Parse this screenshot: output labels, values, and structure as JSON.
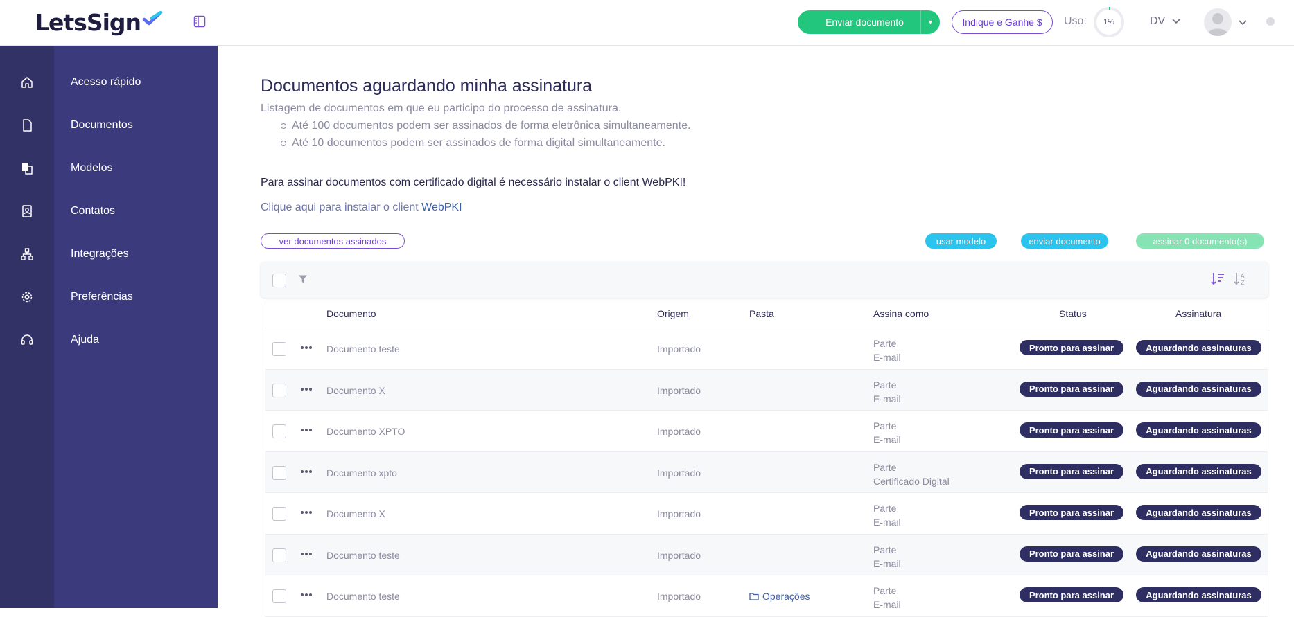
{
  "header": {
    "logo": "LetsSign",
    "send_button": "Enviar documento",
    "refer_button": "Indique e Ganhe $",
    "usage_label": "Uso:",
    "usage_value": "1%",
    "usage_fraction": 0.01,
    "user_initials": "DV"
  },
  "sidebar": {
    "items": [
      {
        "label": "Acesso rápido",
        "icon": "home-icon"
      },
      {
        "label": "Documentos",
        "icon": "document-icon"
      },
      {
        "label": "Modelos",
        "icon": "templates-icon"
      },
      {
        "label": "Contatos",
        "icon": "contacts-icon"
      },
      {
        "label": "Integrações",
        "icon": "integrations-icon"
      },
      {
        "label": "Preferências",
        "icon": "gear-icon"
      },
      {
        "label": "Ajuda",
        "icon": "headset-icon"
      }
    ]
  },
  "main": {
    "title": "Documentos aguardando minha assinatura",
    "subtitle": "Listagem de documentos em que eu participo do processo de assinatura.",
    "bullets": [
      "Até 100 documentos podem ser assinados de forma eletrônica simultaneamente.",
      "Até 10 documentos podem ser assinados de forma digital simultaneamente."
    ],
    "note": "Para assinar documentos com certificado digital é necessário instalar o client WebPKI!",
    "install_prefix": "Clique aqui para instalar o client ",
    "install_link": "WebPKI",
    "view_signed_button": "ver documentos assinados",
    "use_template_button": "usar modelo",
    "send_document_button": "enviar documento",
    "sign_button": "assinar 0 documento(s)"
  },
  "colors": {
    "sidebar_rail": "#333266",
    "sidebar_panel": "#3b3a7c",
    "primary_green": "#22c77d",
    "accent_purple": "#7b4dd6",
    "cyan": "#2bc4ee",
    "badge_dark": "#2f2e62"
  },
  "table": {
    "columns": {
      "document": "Documento",
      "origin": "Origem",
      "folder": "Pasta",
      "sign_as": "Assina como",
      "status": "Status",
      "signature": "Assinatura"
    },
    "rows": [
      {
        "document": "Documento teste",
        "origin": "Importado",
        "folder": "",
        "sign_role": "Parte",
        "sign_method": "E-mail",
        "status": "Pronto para assinar",
        "signature": "Aguardando assinaturas"
      },
      {
        "document": "Documento X",
        "origin": "Importado",
        "folder": "",
        "sign_role": "Parte",
        "sign_method": "E-mail",
        "status": "Pronto para assinar",
        "signature": "Aguardando assinaturas"
      },
      {
        "document": "Documento XPTO",
        "origin": "Importado",
        "folder": "",
        "sign_role": "Parte",
        "sign_method": "E-mail",
        "status": "Pronto para assinar",
        "signature": "Aguardando assinaturas"
      },
      {
        "document": "Documento xpto",
        "origin": "Importado",
        "folder": "",
        "sign_role": "Parte",
        "sign_method": "Certificado Digital",
        "status": "Pronto para assinar",
        "signature": "Aguardando assinaturas"
      },
      {
        "document": "Documento X",
        "origin": "Importado",
        "folder": "",
        "sign_role": "Parte",
        "sign_method": "E-mail",
        "status": "Pronto para assinar",
        "signature": "Aguardando assinaturas"
      },
      {
        "document": "Documento teste",
        "origin": "Importado",
        "folder": "",
        "sign_role": "Parte",
        "sign_method": "E-mail",
        "status": "Pronto para assinar",
        "signature": "Aguardando assinaturas"
      },
      {
        "document": "Documento teste",
        "origin": "Importado",
        "folder": "Operações",
        "sign_role": "Parte",
        "sign_method": "E-mail",
        "status": "Pronto para assinar",
        "signature": "Aguardando assinaturas"
      }
    ]
  }
}
